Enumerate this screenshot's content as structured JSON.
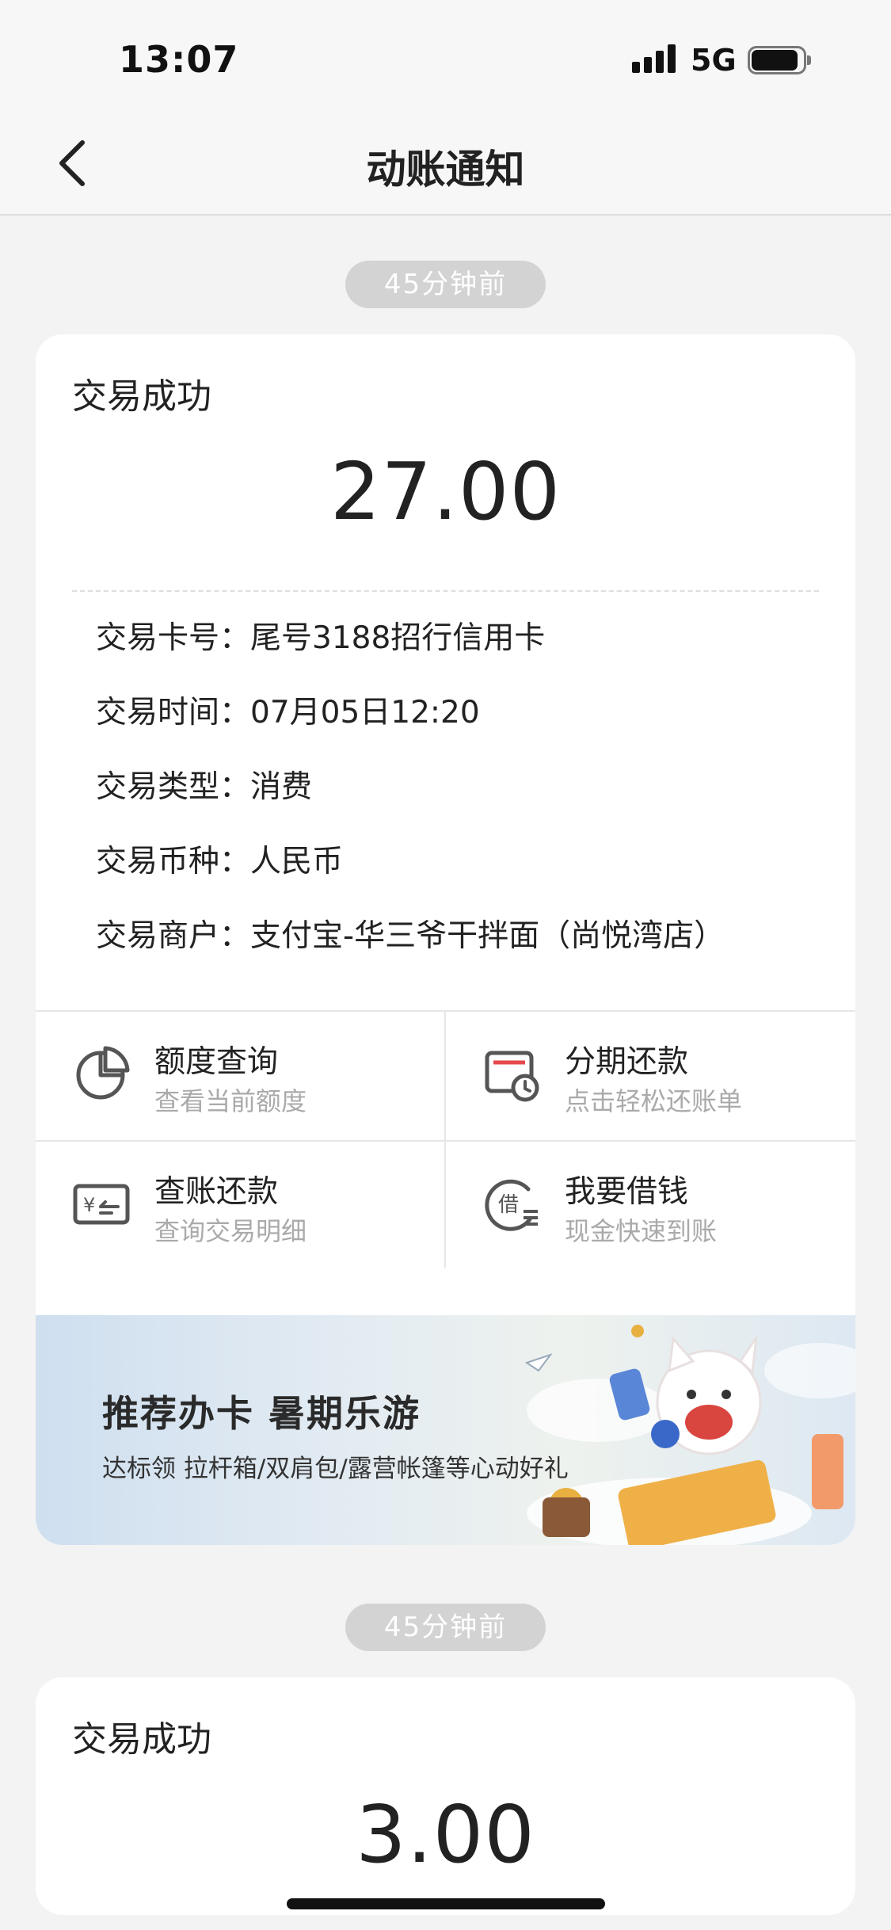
{
  "status_bar": {
    "time": "13:07",
    "network": "5G"
  },
  "nav": {
    "title": "动账通知"
  },
  "notifications": [
    {
      "time_pill": "45分钟前",
      "status": "交易成功",
      "amount": "27.00",
      "details": [
        {
          "label": "交易卡号：",
          "value": "尾号3188招行信用卡"
        },
        {
          "label": "交易时间：",
          "value": "07月05日12:20"
        },
        {
          "label": "交易类型：",
          "value": "消费"
        },
        {
          "label": "交易币种：",
          "value": "人民币"
        },
        {
          "label": "交易商户：",
          "value": "支付宝-华三爷干拌面（尚悦湾店）"
        }
      ]
    },
    {
      "time_pill": "45分钟前",
      "status": "交易成功",
      "amount": "3.00"
    }
  ],
  "actions": [
    {
      "title": "额度查询",
      "subtitle": "查看当前额度",
      "icon": "pie-chart-icon"
    },
    {
      "title": "分期还款",
      "subtitle": "点击轻松还账单",
      "icon": "bill-clock-icon"
    },
    {
      "title": "查账还款",
      "subtitle": "查询交易明细",
      "icon": "yuan-card-icon"
    },
    {
      "title": "我要借钱",
      "subtitle": "现金快速到账",
      "icon": "borrow-icon"
    }
  ],
  "banner": {
    "title": "推荐办卡 暑期乐游",
    "subtitle": "达标领 拉杆箱/双肩包/露营帐篷等心动好礼"
  },
  "colors": {
    "accent": "#e5484d",
    "icon": "#555555",
    "background": "#f3f3f3"
  }
}
